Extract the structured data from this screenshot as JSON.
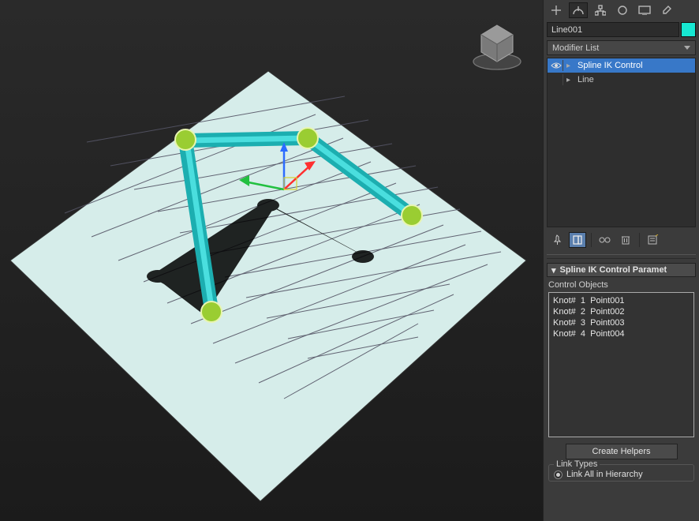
{
  "object_name": "Line001",
  "modifier_dropdown_label": "Modifier List",
  "modifiers": [
    {
      "label": "Spline IK Control",
      "selected": true,
      "has_eye": true
    },
    {
      "label": "Line",
      "selected": false,
      "has_eye": false
    }
  ],
  "rollout_title": "Spline IK Control Paramet",
  "control_objects_label": "Control Objects",
  "control_objects": [
    {
      "knot": "Knot#",
      "idx": "1",
      "name": "Point001"
    },
    {
      "knot": "Knot#",
      "idx": "2",
      "name": "Point002"
    },
    {
      "knot": "Knot#",
      "idx": "3",
      "name": "Point003"
    },
    {
      "knot": "Knot#",
      "idx": "4",
      "name": "Point004"
    }
  ],
  "create_helpers_label": "Create Helpers",
  "link_types_label": "Link Types",
  "link_option_label": "Link All in Hierarchy",
  "colors": {
    "accent": "#3878c8",
    "swatch": "#17e8d2",
    "knot_fill": "#9acd32",
    "tube_fill": "#2fd4d4"
  }
}
